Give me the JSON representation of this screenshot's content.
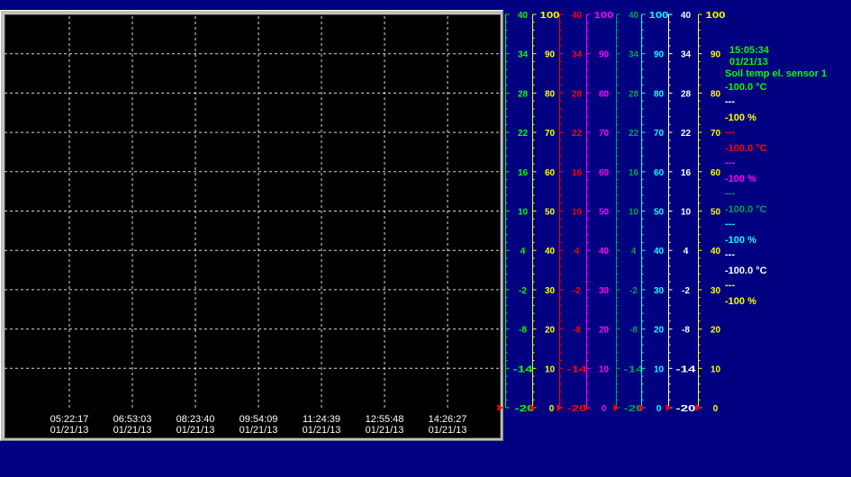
{
  "chart_data": {
    "type": "line",
    "title": "",
    "grid": true,
    "x_ticks": [
      {
        "time": "05:22:17",
        "date": "01/21/13"
      },
      {
        "time": "06:53:03",
        "date": "01/21/13"
      },
      {
        "time": "08:23:40",
        "date": "01/21/13"
      },
      {
        "time": "09:54:09",
        "date": "01/21/13"
      },
      {
        "time": "11:24:39",
        "date": "01/21/13"
      },
      {
        "time": "12:55:48",
        "date": "01/21/13"
      },
      {
        "time": "14:26:27",
        "date": "01/21/13"
      }
    ],
    "axes": [
      {
        "name": "temp-axis-green",
        "color": "#00ff00",
        "ticks": [
          "40",
          "34",
          "28",
          "22",
          "16",
          "10",
          "4",
          "-2",
          "-8",
          "-14",
          "-20"
        ],
        "ylim": [
          -20,
          40
        ]
      },
      {
        "name": "percent-axis-yellow",
        "color": "#ffff00",
        "ticks": [
          "100",
          "90",
          "80",
          "70",
          "60",
          "50",
          "40",
          "30",
          "20",
          "10",
          "0"
        ],
        "ylim": [
          0,
          100
        ]
      },
      {
        "name": "temp-axis-red",
        "color": "#ff0000",
        "ticks": [
          "40",
          "34",
          "28",
          "22",
          "16",
          "10",
          "4",
          "-2",
          "-8",
          "-14",
          "-20"
        ],
        "ylim": [
          -20,
          40
        ]
      },
      {
        "name": "percent-axis-magenta",
        "color": "#ff00ff",
        "ticks": [
          "100",
          "90",
          "80",
          "70",
          "60",
          "50",
          "40",
          "30",
          "20",
          "10",
          "0"
        ],
        "ylim": [
          0,
          100
        ]
      },
      {
        "name": "temp-axis-darkgreen",
        "color": "#00a050",
        "ticks": [
          "40",
          "34",
          "28",
          "22",
          "16",
          "10",
          "4",
          "-2",
          "-8",
          "-14",
          "-20"
        ],
        "ylim": [
          -20,
          40
        ]
      },
      {
        "name": "percent-axis-cyan",
        "color": "#00ffff",
        "ticks": [
          "100",
          "90",
          "80",
          "70",
          "60",
          "50",
          "40",
          "30",
          "20",
          "10",
          "0"
        ],
        "ylim": [
          0,
          100
        ]
      },
      {
        "name": "temp-axis-white",
        "color": "#ffffff",
        "ticks": [
          "40",
          "34",
          "28",
          "22",
          "16",
          "10",
          "4",
          "-2",
          "-8",
          "-14",
          "-20"
        ],
        "ylim": [
          -20,
          40
        ]
      },
      {
        "name": "percent-axis-yellow-2",
        "color": "#ffff00",
        "ticks": [
          "100",
          "90",
          "80",
          "70",
          "60",
          "50",
          "40",
          "30",
          "20",
          "10",
          "0"
        ],
        "ylim": [
          0,
          100
        ]
      }
    ],
    "series": []
  },
  "readout": {
    "time": "15:05:34",
    "date": "01/21/13",
    "sensor": "Soil temp el. sensor 1",
    "rows": [
      {
        "text": "-100.0 °C",
        "color": "#00ff00",
        "kind": "value"
      },
      {
        "text": "---",
        "color": "#ffffff",
        "kind": "dash"
      },
      {
        "text": "-100 %",
        "color": "#ffff00",
        "kind": "value"
      },
      {
        "text": "---",
        "color": "#ff0000",
        "kind": "dash"
      },
      {
        "text": "-100.0 °C",
        "color": "#ff0000",
        "kind": "value"
      },
      {
        "text": "---",
        "color": "#ff00ff",
        "kind": "dash"
      },
      {
        "text": "-100 %",
        "color": "#ff00ff",
        "kind": "value"
      },
      {
        "text": "---",
        "color": "#00a050",
        "kind": "dash"
      },
      {
        "text": "-100.0 °C",
        "color": "#00a050",
        "kind": "value"
      },
      {
        "text": "---",
        "color": "#00ffff",
        "kind": "dash"
      },
      {
        "text": "-100 %",
        "color": "#00ffff",
        "kind": "value"
      },
      {
        "text": "---",
        "color": "#ffffff",
        "kind": "dash"
      },
      {
        "text": "-100.0 °C",
        "color": "#ffffff",
        "kind": "value"
      },
      {
        "text": "---",
        "color": "#ffff00",
        "kind": "dash"
      },
      {
        "text": "-100 %",
        "color": "#ffff00",
        "kind": "value"
      }
    ]
  },
  "colors": {
    "background": "#000080",
    "plot_background": "#000000",
    "grid": "#ffffff",
    "readout_header": "#00ff00",
    "marker": "#ff0000"
  }
}
